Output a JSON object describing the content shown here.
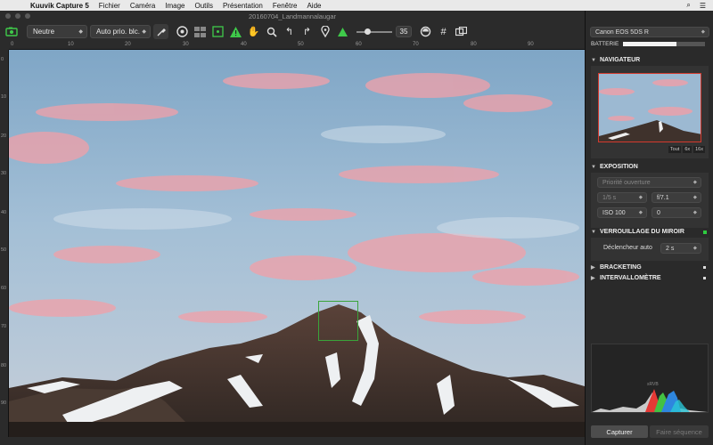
{
  "menubar": {
    "app_name": "Kuuvik Capture 5",
    "items": [
      "Fichier",
      "Caméra",
      "Image",
      "Outils",
      "Présentation",
      "Fenêtre",
      "Aide"
    ]
  },
  "window": {
    "title": "20160704_Landmannalaugar"
  },
  "toolbar": {
    "color_profile": "Neutre",
    "white_balance": "Auto prio. blc.",
    "slider_value": "35",
    "slider_fraction": 0.3
  },
  "rulers": {
    "top": [
      "0",
      "10",
      "20",
      "30",
      "40",
      "50",
      "60",
      "70",
      "80",
      "90"
    ],
    "left": [
      "0",
      "10",
      "20",
      "30",
      "40",
      "50",
      "60",
      "70",
      "80",
      "90"
    ]
  },
  "panel": {
    "camera": "Canon EOS 5DS R",
    "battery_label": "BATTERIE",
    "battery_level": 0.65,
    "navigator": {
      "title": "NAVIGATEUR",
      "zoom_options": [
        "Tout",
        "6x",
        "16x"
      ]
    },
    "exposure": {
      "title": "EXPOSITION",
      "mode": "Priorité ouverture",
      "shutter": "1/5 s",
      "aperture": "f/7.1",
      "iso": "ISO 100",
      "compensation": "0"
    },
    "mirror_lock": {
      "title": "VERROUILLAGE DU MIROIR",
      "release_label": "Déclencheur auto",
      "release_value": "2 s"
    },
    "bracketing": {
      "title": "BRACKETING"
    },
    "interval": {
      "title": "INTERVALLOMÈTRE"
    },
    "histogram": {
      "label": "sRVB"
    },
    "buttons": {
      "capture": "Capturer",
      "sequence": "Faire séquence"
    }
  },
  "colors": {
    "accent_green": "#3fc94a",
    "nav_frame": "#d43a2e"
  }
}
